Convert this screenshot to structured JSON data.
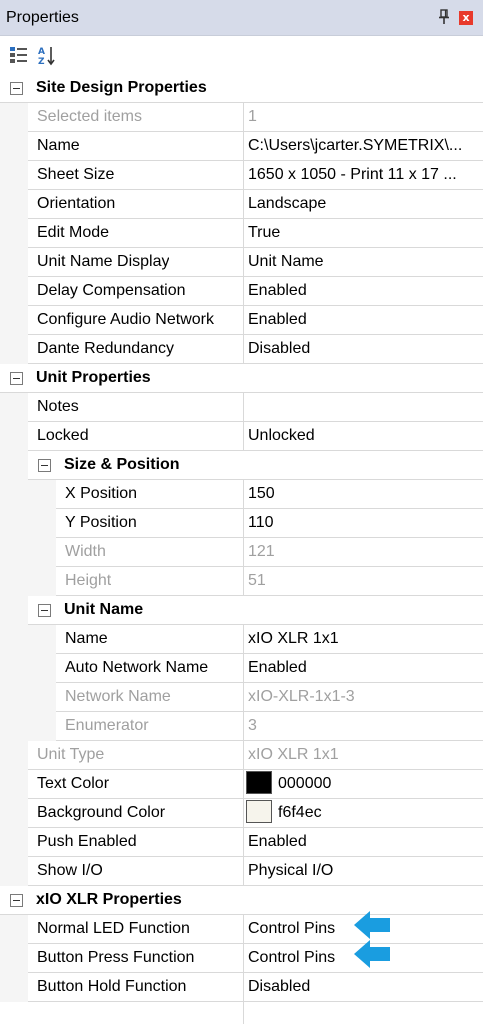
{
  "panel": {
    "title": "Properties",
    "pin_glyph": "‡",
    "close_glyph": "x"
  },
  "toolbar": {
    "categorized_icon": "categorized-list-icon",
    "alphabetical_icon": "sort-az-icon"
  },
  "categories": {
    "site": "Site Design Properties",
    "unit": "Unit Properties",
    "size_position": "Size & Position",
    "unit_name": "Unit Name",
    "xio": "xIO XLR Properties"
  },
  "rows": {
    "selected_items": {
      "name": "Selected items",
      "value": "1"
    },
    "name": {
      "name": "Name",
      "value": "C:\\Users\\jcarter.SYMETRIX\\..."
    },
    "sheet_size": {
      "name": "Sheet Size",
      "value": "1650 x 1050 - Print 11 x 17 ..."
    },
    "orientation": {
      "name": "Orientation",
      "value": "Landscape"
    },
    "edit_mode": {
      "name": "Edit Mode",
      "value": "True"
    },
    "unit_name_display": {
      "name": "Unit Name Display",
      "value": "Unit Name"
    },
    "delay_comp": {
      "name": "Delay Compensation",
      "value": "Enabled"
    },
    "config_audio": {
      "name": "Configure Audio Network",
      "value": "Enabled"
    },
    "dante": {
      "name": "Dante Redundancy",
      "value": "Disabled"
    },
    "notes": {
      "name": "Notes",
      "value": ""
    },
    "locked": {
      "name": "Locked",
      "value": "Unlocked"
    },
    "x_pos": {
      "name": "X Position",
      "value": "150"
    },
    "y_pos": {
      "name": "Y Position",
      "value": "110"
    },
    "width": {
      "name": "Width",
      "value": "121"
    },
    "height": {
      "name": "Height",
      "value": "51"
    },
    "unit_name_name": {
      "name": "Name",
      "value": "xIO XLR 1x1"
    },
    "auto_net": {
      "name": "Auto Network Name",
      "value": "Enabled"
    },
    "network_name": {
      "name": "Network Name",
      "value": "xIO-XLR-1x1-3"
    },
    "enumerator": {
      "name": "Enumerator",
      "value": "3"
    },
    "unit_type": {
      "name": "Unit Type",
      "value": "xIO XLR 1x1"
    },
    "text_color": {
      "name": "Text Color",
      "value": "000000",
      "swatch": "#000000"
    },
    "bg_color": {
      "name": "Background Color",
      "value": "f6f4ec",
      "swatch": "#f6f4ec"
    },
    "push_enabled": {
      "name": "Push Enabled",
      "value": "Enabled"
    },
    "show_io": {
      "name": "Show I/O",
      "value": "Physical I/O"
    },
    "normal_led": {
      "name": "Normal LED Function",
      "value": "Control Pins"
    },
    "button_press": {
      "name": "Button Press Function",
      "value": "Control Pins"
    },
    "button_hold": {
      "name": "Button Hold Function",
      "value": "Disabled"
    }
  },
  "colors": {
    "arrow": "#1a9de0",
    "titlebar": "#d6dbe9",
    "close": "#e8392b"
  }
}
